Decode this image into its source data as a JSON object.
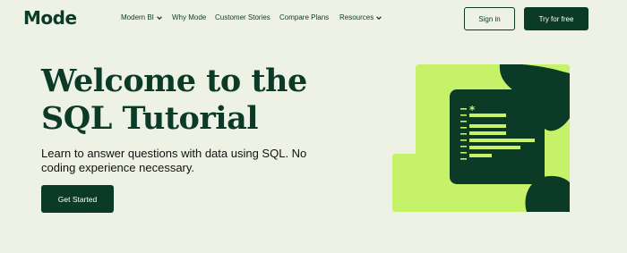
{
  "brand": {
    "logo_text": "Mode"
  },
  "nav": {
    "items": [
      {
        "label": "Modern BI",
        "has_dropdown": true
      },
      {
        "label": "Why Mode",
        "has_dropdown": false
      },
      {
        "label": "Customer Stories",
        "has_dropdown": false
      },
      {
        "label": "Compare Plans",
        "has_dropdown": false
      },
      {
        "label": "Resources",
        "has_dropdown": true
      }
    ],
    "sign_in_label": "Sign in",
    "try_free_label": "Try for free"
  },
  "hero": {
    "title_line1": "Welcome to the",
    "title_line2": "SQL Tutorial",
    "subtitle_line1": "Learn to answer questions with data using SQL. No",
    "subtitle_line2": "coding experience necessary.",
    "cta_label": "Get Started"
  },
  "illustration": {
    "asterisk": "*"
  },
  "colors": {
    "background": "#eef2e4",
    "brand_dark": "#0b3b27",
    "lime": "#c6f26a",
    "bar_lime": "#c6f26a"
  }
}
